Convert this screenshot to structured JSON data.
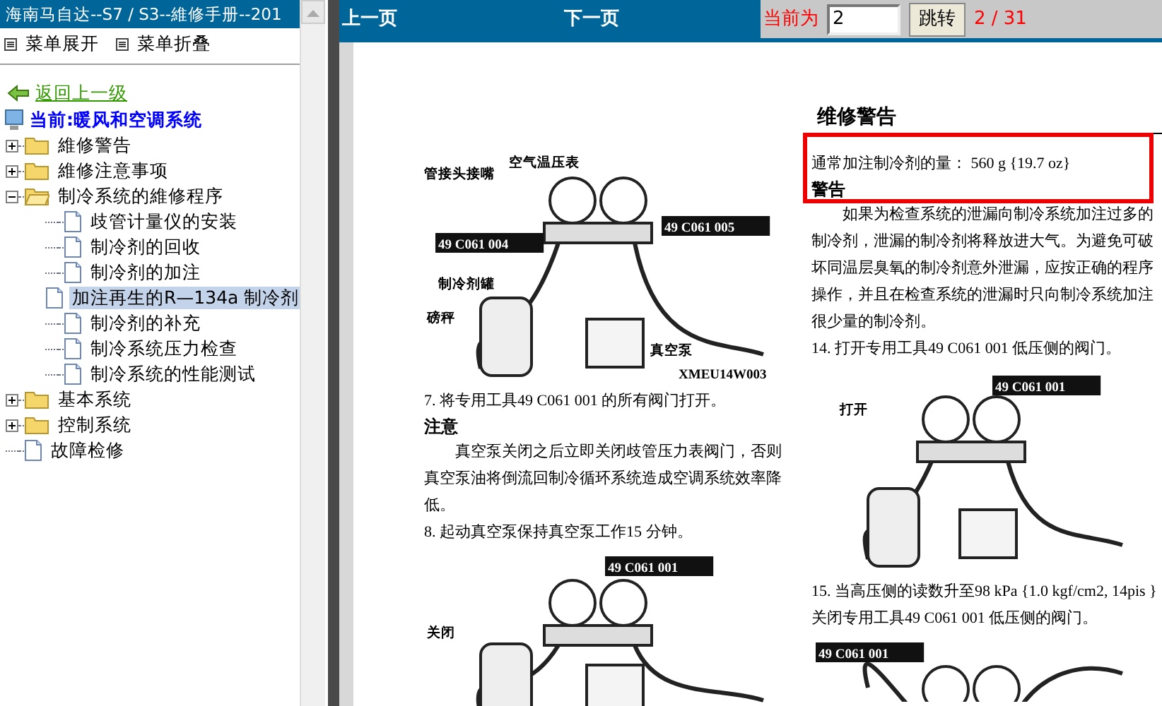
{
  "sidebar": {
    "title": "海南马自达--S7 / S3--維修手册--201",
    "menu_buttons": [
      {
        "label": "菜单展开"
      },
      {
        "label": "菜单折叠"
      }
    ],
    "back_link": "返回上一级",
    "current": "当前:暖风和空调系统",
    "tree": [
      {
        "kind": "folder",
        "label": "維修警告",
        "expanded": false
      },
      {
        "kind": "folder",
        "label": "維修注意事项",
        "expanded": false
      },
      {
        "kind": "folder",
        "label": "制冷系统的維修程序",
        "expanded": true,
        "children": [
          {
            "kind": "page",
            "label": "歧管计量仪的安装",
            "selected": false
          },
          {
            "kind": "page",
            "label": "制冷剂的回收",
            "selected": false
          },
          {
            "kind": "page",
            "label": "制冷剂的加注",
            "selected": false
          },
          {
            "kind": "page",
            "label": "加注再生的R—134a 制冷剂",
            "selected": true
          },
          {
            "kind": "page",
            "label": "制冷剂的补充",
            "selected": false
          },
          {
            "kind": "page",
            "label": "制冷系统压力检查",
            "selected": false
          },
          {
            "kind": "page",
            "label": "制冷系统的性能测试",
            "selected": false
          }
        ]
      },
      {
        "kind": "folder",
        "label": "基本系统",
        "expanded": false
      },
      {
        "kind": "folder",
        "label": "控制系统",
        "expanded": false
      },
      {
        "kind": "page",
        "label": "故障检修",
        "selected": false
      }
    ]
  },
  "toolbar": {
    "prev": "上一页",
    "next": "下一页",
    "current_label": "当前为",
    "page_value": "2",
    "go_button": "跳转",
    "page_count": "2 / 31"
  },
  "document": {
    "title": "维修警告",
    "left": [
      {
        "kind": "figure",
        "labels": [
          "管接头接嘴",
          "空气温压表",
          "49 C061 004",
          "49 C061 005",
          "制冷剂罐",
          "磅秤",
          "真空泵",
          "XMEU14W003"
        ]
      },
      {
        "kind": "text",
        "text": "7. 将专用工具49 C061 001 的所有阀门打开。"
      },
      {
        "kind": "heading",
        "text": "注意"
      },
      {
        "kind": "para",
        "text": "真空泵关闭之后立即关闭歧管压力表阀门，否则真空泵油将倒流回制冷循环系统造成空调系统效率降低。"
      },
      {
        "kind": "text",
        "text": "8. 起动真空泵保持真空泵工作15 分钟。"
      },
      {
        "kind": "figure",
        "labels": [
          "49 C061 001",
          "关闭"
        ]
      }
    ],
    "right": [
      {
        "kind": "text",
        "text": "通常加注制冷剂的量： 560 g {19.7 oz}"
      },
      {
        "kind": "heading",
        "text": "警告"
      },
      {
        "kind": "para",
        "text": "如果为检查系统的泄漏向制冷系统加注过多的制冷剂，泄漏的制冷剂将释放进大气。为避免可破坏同温层臭氧的制冷剂意外泄漏，应按正确的程序操作，并且在检查系统的泄漏时只向制冷系统加注很少量的制冷剂。"
      },
      {
        "kind": "text",
        "text": "14. 打开专用工具49 C061 001 低压侧的阀门。"
      },
      {
        "kind": "figure",
        "labels": [
          "49 C061 001",
          "打开"
        ]
      },
      {
        "kind": "text",
        "text": "15. 当高压侧的读数升至98 kPa {1.0 kgf/cm2, 14pis } 关闭专用工具49 C061 001 低压侧的阀门。"
      },
      {
        "kind": "figure",
        "labels": [
          "49 C061 001"
        ]
      }
    ]
  }
}
